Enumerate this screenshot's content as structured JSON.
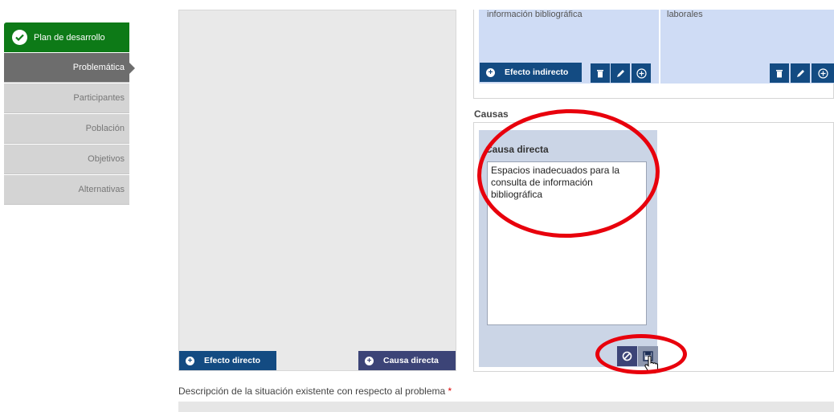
{
  "nav": {
    "plan": "Plan de desarrollo",
    "items": [
      "Problemática",
      "Participantes",
      "Población",
      "Objetivos",
      "Alternativas"
    ]
  },
  "effects": {
    "card1_text": "información bibliográfica",
    "card2_text": "laborales",
    "efecto_indirecto_label": "Efecto indirecto"
  },
  "causas": {
    "title": "Causas",
    "card_title": "Causa directa",
    "textarea_value": "Espacios inadecuados para la consulta de información bibliográfica"
  },
  "buttons": {
    "efecto_directo": "Efecto directo",
    "causa_directa": "Causa directa"
  },
  "description_label": "Descripción de la situación existente con respecto al problema",
  "required_mark": "*",
  "colors": {
    "accent_blue": "#134b82",
    "nav_green": "#0d7a17",
    "annotation_red": "#e8000c"
  }
}
